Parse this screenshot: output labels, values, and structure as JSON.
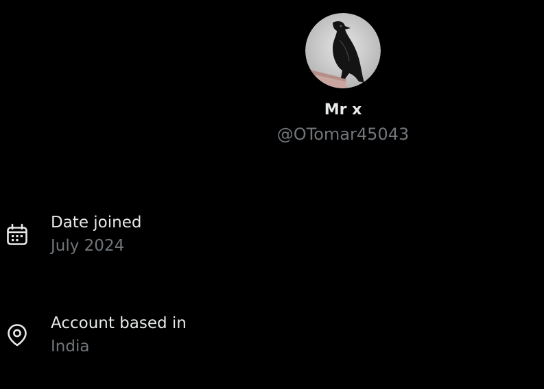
{
  "profile": {
    "display_name": "Mr x",
    "handle": "@OTomar45043",
    "avatar_icon": "crow-avatar"
  },
  "details": {
    "date_joined": {
      "icon": "calendar-icon",
      "label": "Date joined",
      "value": "July 2024"
    },
    "account_based_in": {
      "icon": "location-pin-icon",
      "label": "Account based in",
      "value": "India"
    }
  },
  "colors": {
    "background": "#000000",
    "primary_text": "#e7e9ea",
    "secondary_text": "#71767b"
  }
}
